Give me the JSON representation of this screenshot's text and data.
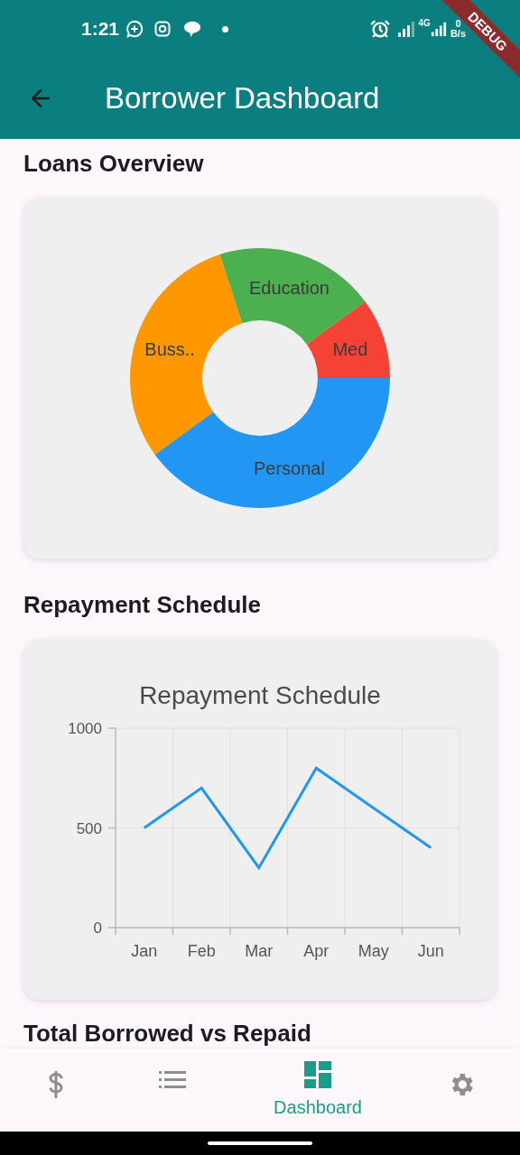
{
  "status_bar": {
    "time": "1:21",
    "network": "4G",
    "speed_value": "0",
    "speed_unit": "B/s"
  },
  "debug_banner": "DEBUG",
  "app_bar": {
    "title": "Borrower Dashboard"
  },
  "sections": [
    {
      "title": "Loans Overview",
      "chart_data": {
        "type": "donut",
        "categories": [
          "Personal",
          "Buss..",
          "Education",
          "Med"
        ],
        "values": [
          40,
          30,
          20,
          10
        ],
        "colors": [
          "#2196f3",
          "#ff9800",
          "#4caf50",
          "#f44336"
        ]
      }
    },
    {
      "title": "Repayment Schedule",
      "chart_data": {
        "type": "line",
        "title": "Repayment Schedule",
        "categories": [
          "Jan",
          "Feb",
          "Mar",
          "Apr",
          "May",
          "Jun"
        ],
        "series": [
          {
            "color": "#2196f3",
            "values": [
              500,
              700,
              300,
              800,
              600,
              400
            ]
          }
        ],
        "ylim": [
          0,
          1000
        ],
        "yticks": [
          0,
          500,
          1000
        ]
      }
    },
    {
      "title": "Total Borrowed vs Repaid"
    }
  ],
  "bottom_nav": [
    {
      "selected": false
    },
    {
      "selected": false
    },
    {
      "label": "Dashboard",
      "selected": true
    },
    {
      "selected": false
    }
  ]
}
